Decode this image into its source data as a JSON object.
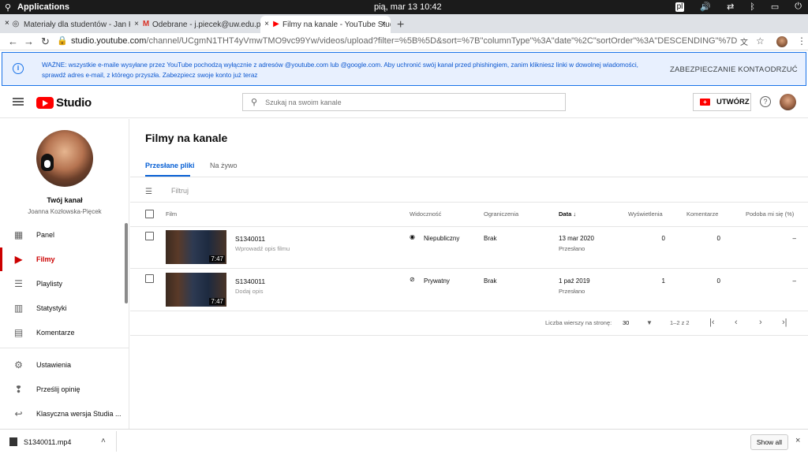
{
  "os": {
    "apps_label": "Applications",
    "datetime": "pią, mar 13   10:42",
    "lang": "pl"
  },
  "tabs": [
    {
      "label": "Materiały dla studentów - Jan K"
    },
    {
      "label": "Odebrane - j.piecek@uw.edu.pl"
    },
    {
      "label": "Filmy na kanale - YouTube Studi"
    }
  ],
  "address": {
    "host": "studio.youtube.com",
    "path": "/channel/UCgmN1THT4yVmwTMO9vc99Yw/videos/upload?filter=%5B%5D&sort=%7B\"columnType\"%3A\"date\"%2C\"sortOrder\"%3A\"DESCENDING\"%7D"
  },
  "banner": {
    "message": "WAŻNE: wszystkie e-maile wysyłane przez YouTube pochodzą wyłącznie z adresów @youtube.com lub @google.com. Aby uchronić swój kanał przed phishingiem, zanim klikniesz linki w dowolnej wiadomości, sprawdź adres e-mail, z którego przyszła. Zabezpiecz swoje konto już teraz",
    "secure_btn": "ZABEZPIECZANIE KONTA",
    "dismiss_btn": "ODRZUĆ"
  },
  "header": {
    "logo_text": "Studio",
    "search_placeholder": "Szukaj na swoim kanale",
    "create_label": "UTWÓRZ"
  },
  "channel": {
    "title": "Twój kanał",
    "name": "Joanna Kozłowska-Pięcek"
  },
  "sidebar": {
    "items": [
      {
        "label": "Panel",
        "icon": "dashboard-icon"
      },
      {
        "label": "Filmy",
        "icon": "videos-icon"
      },
      {
        "label": "Playlisty",
        "icon": "playlists-icon"
      },
      {
        "label": "Statystyki",
        "icon": "analytics-icon"
      },
      {
        "label": "Komentarze",
        "icon": "comments-icon"
      },
      {
        "label": "Ustawienia",
        "icon": "gear-icon"
      },
      {
        "label": "Prześlij opinię",
        "icon": "feedback-icon"
      },
      {
        "label": "Klasyczna wersja Studia ...",
        "icon": "classic-icon"
      }
    ]
  },
  "main": {
    "title": "Filmy na kanale",
    "tabs": [
      "Przesłane pliki",
      "Na żywo"
    ],
    "filter_placeholder": "Filtruj",
    "columns": {
      "film": "Film",
      "visibility": "Widoczność",
      "restrictions": "Ograniczenia",
      "date": "Data",
      "views": "Wyświetlenia",
      "comments": "Komentarze",
      "likes": "Podoba mi się (%)"
    },
    "rows": [
      {
        "title": "S1340011",
        "desc": "Wprowadź opis filmu",
        "duration": "7:47",
        "visibility": "Niepubliczny",
        "restrictions": "Brak",
        "date": "13 mar 2020",
        "date_sub": "Przesłano",
        "views": "0",
        "comments": "0",
        "likes": "–"
      },
      {
        "title": "S1340011",
        "desc": "Dodaj opis",
        "duration": "7:47",
        "visibility": "Prywatny",
        "restrictions": "Brak",
        "date": "1 paź 2019",
        "date_sub": "Przesłano",
        "views": "1",
        "comments": "0",
        "likes": "–"
      }
    ],
    "pagination": {
      "rows_label": "Liczba wierszy na stronę:",
      "rows_value": "30",
      "range": "1–2 z 2"
    }
  },
  "downloads": {
    "file": "S1340011.mp4",
    "show_all": "Show all"
  }
}
